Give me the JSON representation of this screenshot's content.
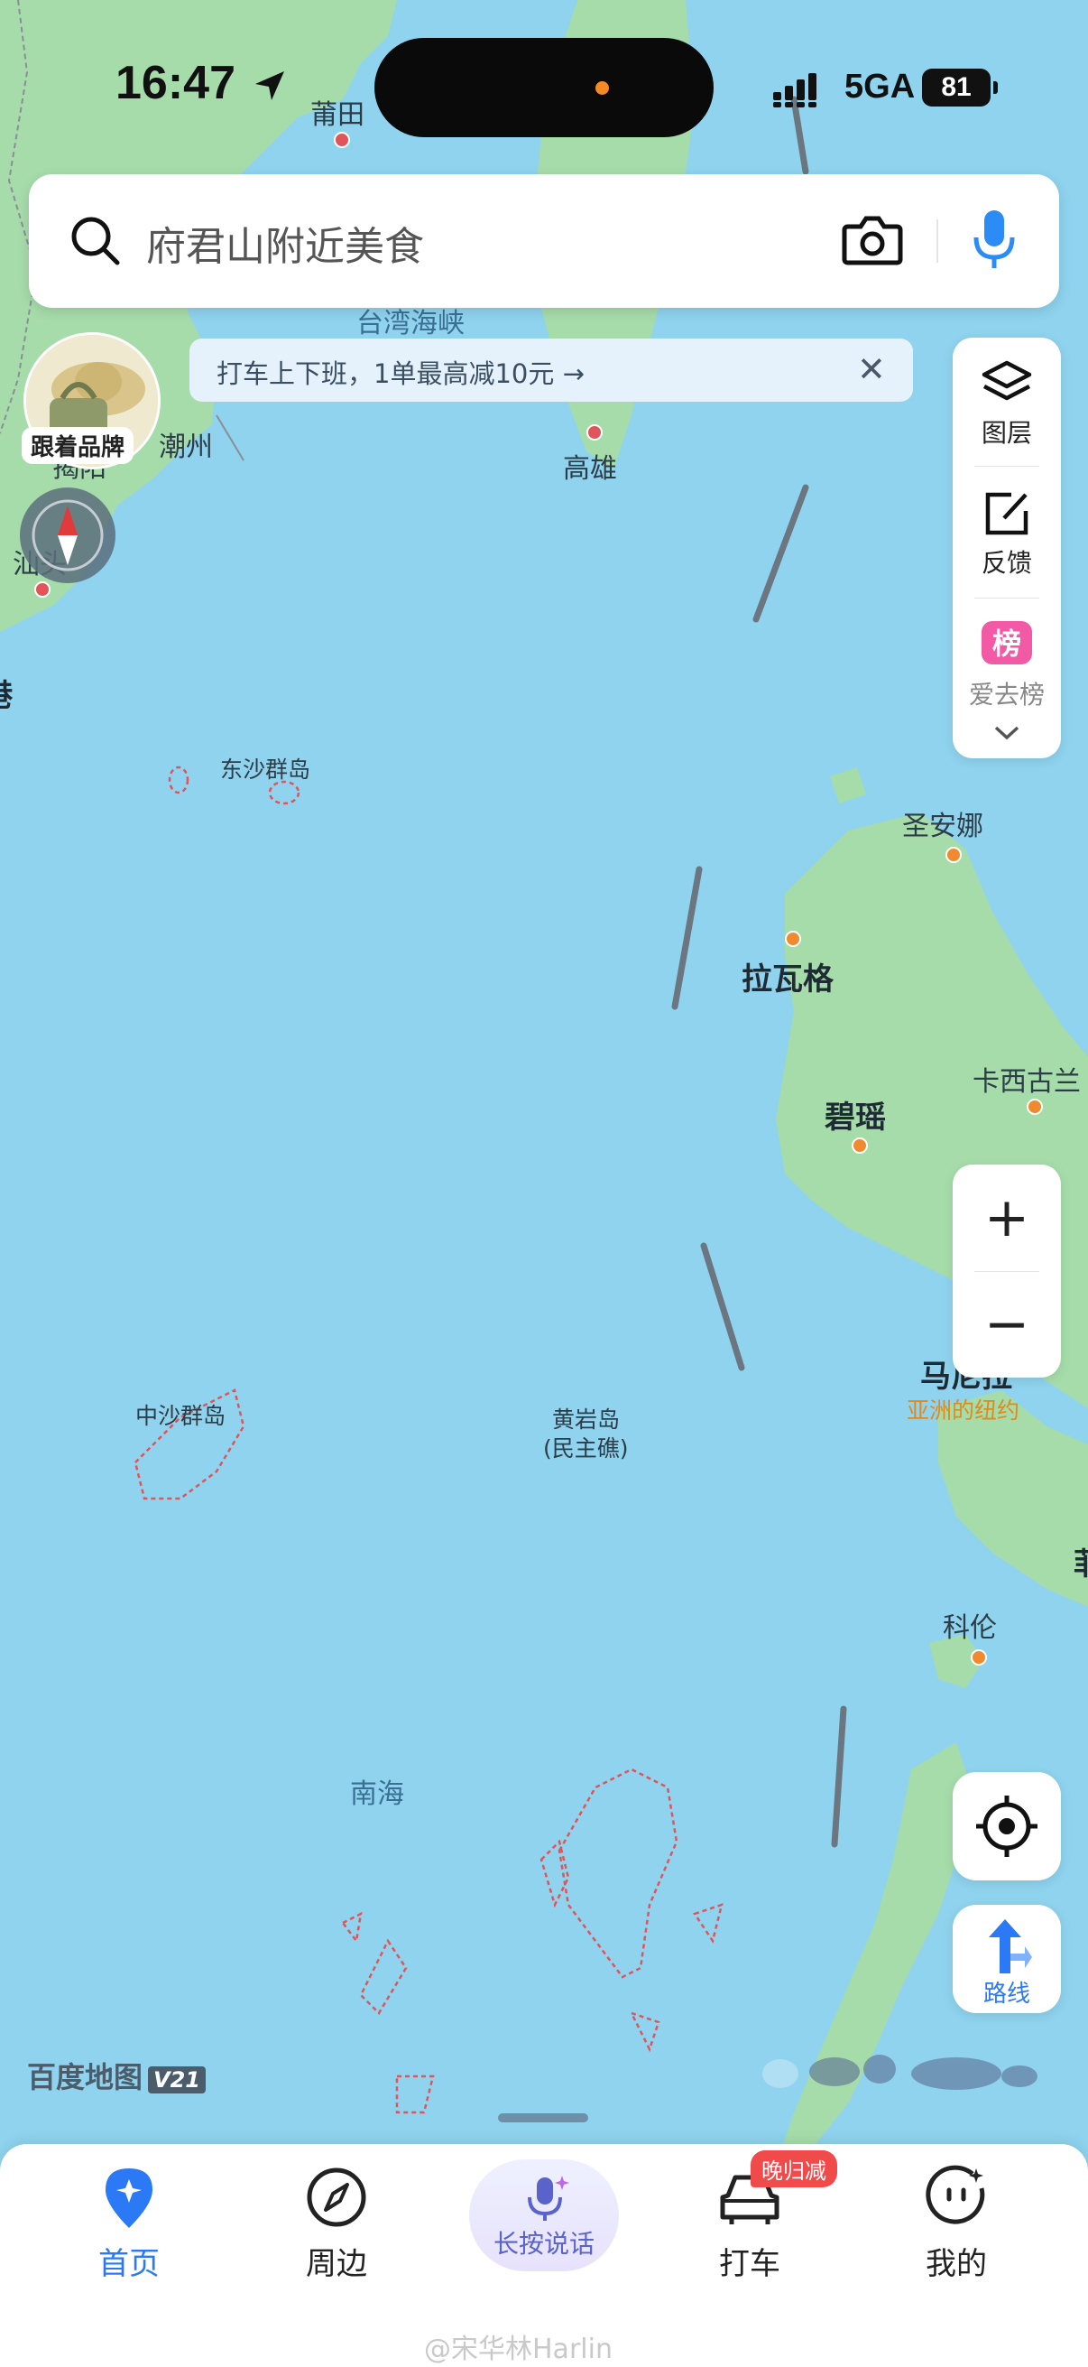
{
  "status_bar": {
    "time": "16:47",
    "network": "5GA",
    "battery": "81"
  },
  "search": {
    "placeholder": "府君山附近美食"
  },
  "banner": {
    "text": "打车上下班，1单最高减10元 →"
  },
  "left_buttons": {
    "brand_label": "跟着品牌"
  },
  "tools": {
    "layers": "图层",
    "feedback": "反馈",
    "rank": "爱去榜"
  },
  "zoom": {
    "plus": "+",
    "minus": "−"
  },
  "route": {
    "label": "路线"
  },
  "map": {
    "labels": {
      "putian": "莆田",
      "taiwan_strait": "台湾海峡",
      "chaozhou": "潮州",
      "jieyang": "揭阳",
      "shantou": "汕头",
      "hk_partial": "港",
      "gaoxiong": "高雄",
      "dongsha": "东沙群岛",
      "san_ana": "圣安娜",
      "laoag": "拉瓦格",
      "vigan": "碧瑶",
      "cagayan": "卡西古兰",
      "manila": "马尼拉",
      "manila_sub": "亚洲的纽约",
      "zhongsha": "中沙群岛",
      "huangyan": "黄岩岛",
      "huangyan_sub": "(民主礁)",
      "coron": "科伦",
      "nanhai": "南海",
      "right_edge": "菲"
    }
  },
  "logo": {
    "name": "百度地图",
    "version": "V21"
  },
  "nav": {
    "home": "首页",
    "nearby": "周边",
    "talk": "长按说话",
    "taxi": "打车",
    "taxi_badge": "晚归减",
    "mine": "我的"
  },
  "watermark": "@宋华林Harlin",
  "colors": {
    "accent": "#2b79f5",
    "sea": "#8fd3ee",
    "land": "#a6dcaa",
    "badge": "#f04a4a"
  }
}
